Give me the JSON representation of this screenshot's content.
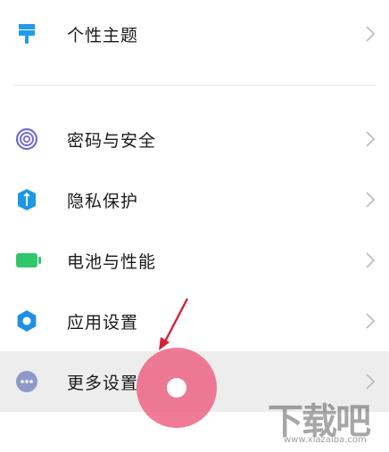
{
  "settings": {
    "items": [
      {
        "label": "个性主题",
        "icon": "theme-brush-icon",
        "color": "#1f9bef"
      },
      {
        "label": "密码与安全",
        "icon": "fingerprint-icon",
        "color": "#6f6bd6"
      },
      {
        "label": "隐私保护",
        "icon": "privacy-shield-icon",
        "color": "#1e96e8"
      },
      {
        "label": "电池与性能",
        "icon": "battery-icon",
        "color": "#30c76a"
      },
      {
        "label": "应用设置",
        "icon": "gear-icon",
        "color": "#1f8fe5"
      },
      {
        "label": "更多设置",
        "icon": "more-dots-icon",
        "color": "#8e99c9"
      }
    ]
  },
  "watermark": {
    "text": "下载吧",
    "url": "www.xiazaiba.com"
  },
  "colors": {
    "highlight": "#ededed",
    "touch_indicator": "#ec5e80",
    "arrow": "#d6203a"
  }
}
